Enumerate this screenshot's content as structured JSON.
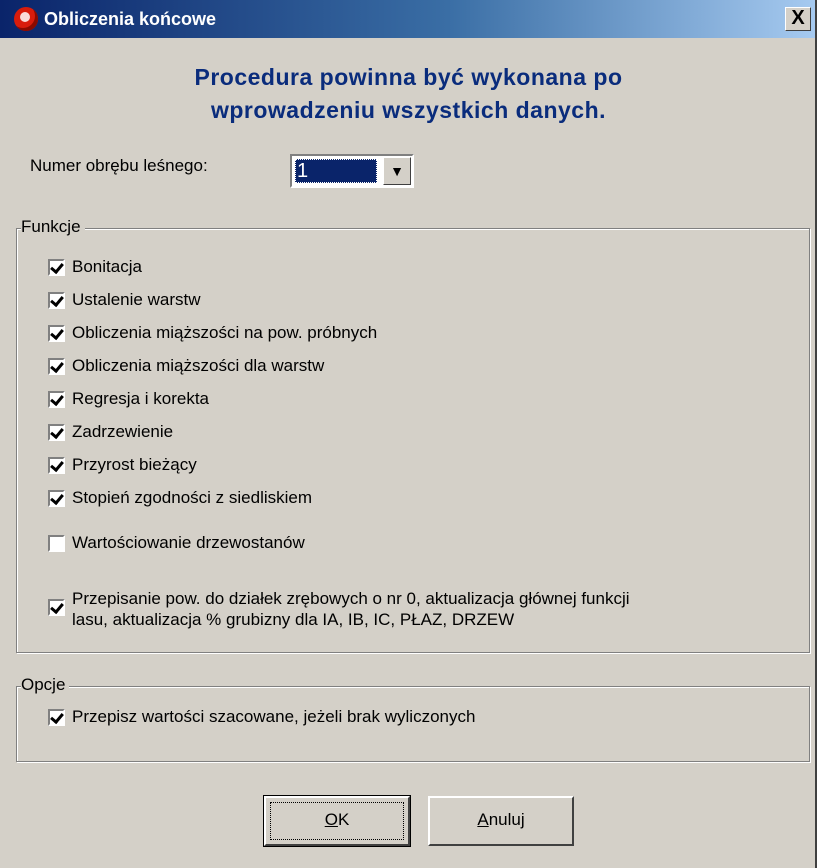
{
  "window": {
    "title": "Obliczenia końcowe",
    "close_label": "X"
  },
  "headline": {
    "line1": "Procedura powinna być wykonana po",
    "line2": "wprowadzeniu wszystkich danych."
  },
  "obreb": {
    "label": "Numer obrębu leśnego:",
    "value": "1"
  },
  "funkcje": {
    "legend": "Funkcje",
    "items": [
      {
        "label": "Bonitacja",
        "checked": true
      },
      {
        "label": "Ustalenie warstw",
        "checked": true
      },
      {
        "label": "Obliczenia miąższości na pow. próbnych",
        "checked": true
      },
      {
        "label": "Obliczenia miąższości dla warstw",
        "checked": true
      },
      {
        "label": "Regresja i korekta",
        "checked": true
      },
      {
        "label": "Zadrzewienie",
        "checked": true
      },
      {
        "label": "Przyrost bieżący",
        "checked": true
      },
      {
        "label": "Stopień zgodności z siedliskiem",
        "checked": true
      },
      {
        "label": "Wartościowanie drzewostanów",
        "checked": false
      },
      {
        "label_line1": "Przepisanie pow. do działek zrębowych o nr 0, aktualizacja głównej funkcji",
        "label_line2": "lasu, aktualizacja % grubizny dla  IA, IB, IC, PŁAZ, DRZEW",
        "checked": true
      }
    ]
  },
  "opcje": {
    "legend": "Opcje",
    "items": [
      {
        "label": "Przepisz wartości szacowane, jeżeli brak wyliczonych",
        "checked": true
      }
    ]
  },
  "buttons": {
    "ok": {
      "mnemonic": "O",
      "rest": "K"
    },
    "cancel": {
      "mnemonic": "A",
      "rest": "nuluj"
    }
  }
}
